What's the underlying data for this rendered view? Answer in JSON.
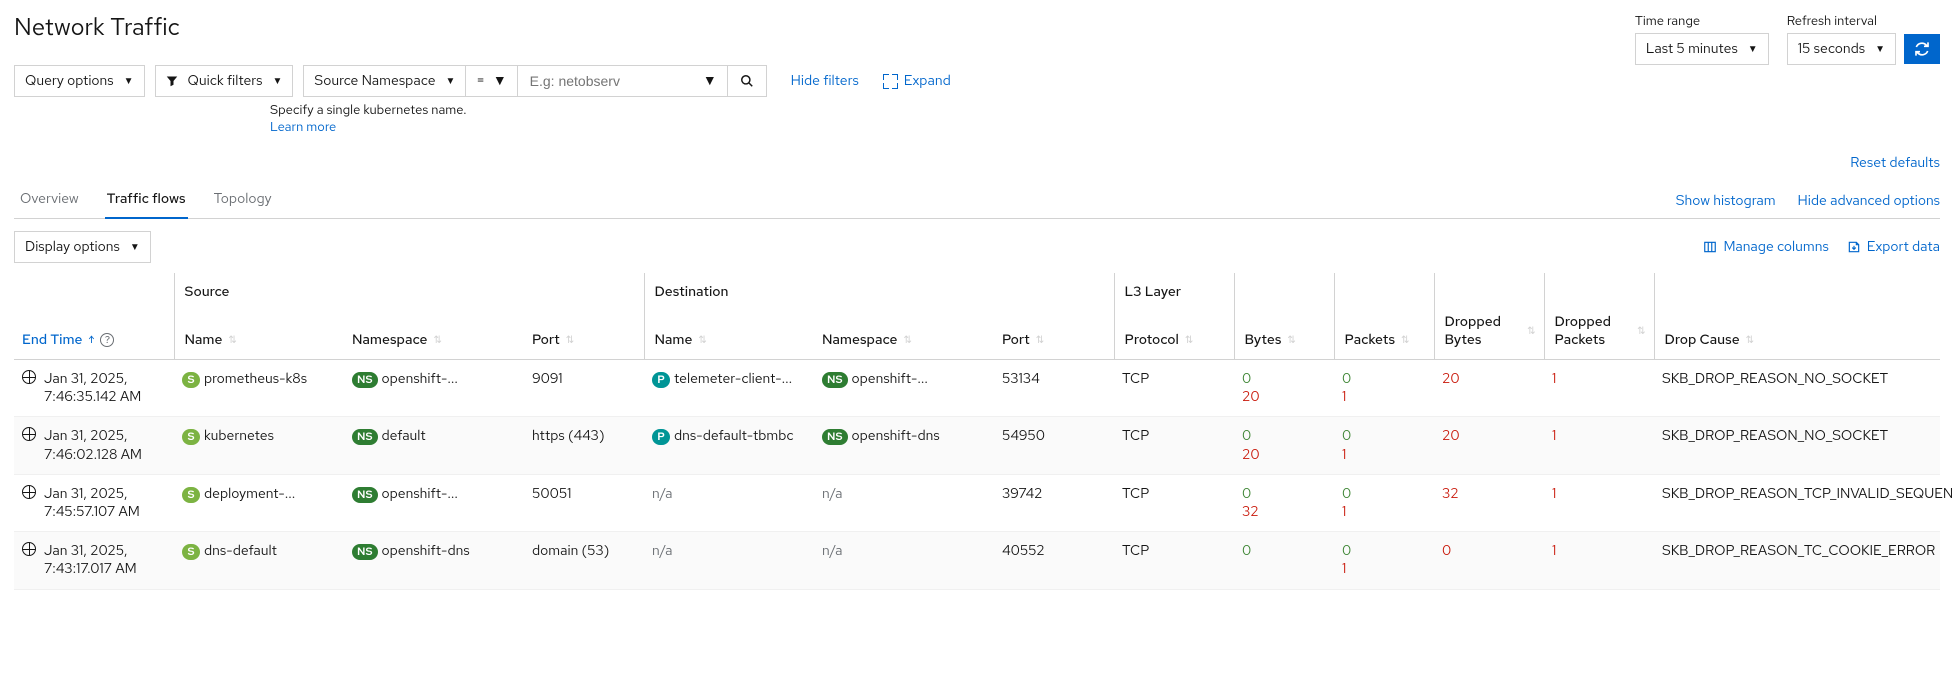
{
  "page_title": "Network Traffic",
  "time_range": {
    "label": "Time range",
    "value": "Last 5 minutes"
  },
  "refresh": {
    "label": "Refresh interval",
    "value": "15 seconds"
  },
  "toolbar": {
    "query_options": "Query options",
    "quick_filters": "Quick filters",
    "filter_field": "Source Namespace",
    "filter_op": "=",
    "filter_placeholder": "E.g: netobserv",
    "hide_filters": "Hide filters",
    "expand": "Expand",
    "helper": "Specify a single kubernetes name.",
    "learn_more": "Learn more",
    "reset_defaults": "Reset defaults"
  },
  "tabs": {
    "overview": "Overview",
    "traffic_flows": "Traffic flows",
    "topology": "Topology",
    "show_hist": "Show histogram",
    "hide_adv": "Hide advanced options"
  },
  "display_options": "Display options",
  "table_actions": {
    "manage_columns": "Manage columns",
    "export_data": "Export data"
  },
  "columns": {
    "end_time": "End Time",
    "source_group": "Source",
    "src_name": "Name",
    "src_ns": "Namespace",
    "src_port": "Port",
    "dest_group": "Destination",
    "dst_name": "Name",
    "dst_ns": "Namespace",
    "dst_port": "Port",
    "l3_group": "L3 Layer",
    "protocol": "Protocol",
    "bytes": "Bytes",
    "packets": "Packets",
    "dropped_bytes": "Dropped Bytes",
    "dropped_packets": "Dropped Packets",
    "drop_cause": "Drop Cause"
  },
  "rows": [
    {
      "date": "Jan 31, 2025,",
      "time": "7:46:35.142 AM",
      "src_name": "prometheus-k8s",
      "src_badge": "S",
      "src_ns": "openshift-...",
      "src_port": "9091",
      "dst_name": "telemeter-client-...",
      "dst_badge": "P",
      "dst_ns": "openshift-...",
      "dst_ns_na": false,
      "dst_port": "53134",
      "protocol": "TCP",
      "bytes_a": "0",
      "bytes_b": "20",
      "packets_a": "0",
      "packets_b": "1",
      "dropped_bytes": "20",
      "dropped_packets": "1",
      "drop_cause": "SKB_DROP_REASON_NO_SOCKET"
    },
    {
      "date": "Jan 31, 2025,",
      "time": "7:46:02.128 AM",
      "src_name": "kubernetes",
      "src_badge": "S",
      "src_ns": "default",
      "src_port": "https (443)",
      "dst_name": "dns-default-tbmbc",
      "dst_badge": "P",
      "dst_ns": "openshift-dns",
      "dst_ns_na": false,
      "dst_port": "54950",
      "protocol": "TCP",
      "bytes_a": "0",
      "bytes_b": "20",
      "packets_a": "0",
      "packets_b": "1",
      "dropped_bytes": "20",
      "dropped_packets": "1",
      "drop_cause": "SKB_DROP_REASON_NO_SOCKET"
    },
    {
      "date": "Jan 31, 2025,",
      "time": "7:45:57.107 AM",
      "src_name": "deployment-...",
      "src_badge": "S",
      "src_ns": "openshift-...",
      "src_port": "50051",
      "dst_name": "n/a",
      "dst_badge": "",
      "dst_ns": "n/a",
      "dst_ns_na": true,
      "dst_port": "39742",
      "protocol": "TCP",
      "bytes_a": "0",
      "bytes_b": "32",
      "packets_a": "0",
      "packets_b": "1",
      "dropped_bytes": "32",
      "dropped_packets": "1",
      "drop_cause": "SKB_DROP_REASON_TCP_INVALID_SEQUENCE"
    },
    {
      "date": "Jan 31, 2025,",
      "time": "7:43:17.017 AM",
      "src_name": "dns-default",
      "src_badge": "S",
      "src_ns": "openshift-dns",
      "src_port": "domain (53)",
      "dst_name": "n/a",
      "dst_badge": "",
      "dst_ns": "n/a",
      "dst_ns_na": true,
      "dst_port": "40552",
      "protocol": "TCP",
      "bytes_a": "0",
      "bytes_b": "",
      "packets_a": "0",
      "packets_b": "1",
      "dropped_bytes": "0",
      "dropped_packets": "1",
      "drop_cause": "SKB_DROP_REASON_TC_COOKIE_ERROR"
    }
  ]
}
